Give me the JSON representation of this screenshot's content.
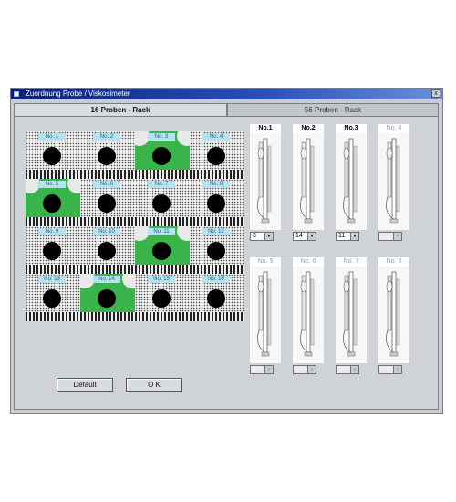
{
  "window": {
    "title": "Zuordnung Probe / Viskosimeter",
    "close_label": "x"
  },
  "tabs": [
    {
      "label": "16 Proben - Rack",
      "active": true
    },
    {
      "label": "56 Proben - Rack",
      "active": false
    }
  ],
  "rack": {
    "cells": [
      {
        "label": "No. 1",
        "selected": false
      },
      {
        "label": "No. 2",
        "selected": false
      },
      {
        "label": "No. 3",
        "selected": true
      },
      {
        "label": "No. 4",
        "selected": false
      },
      {
        "label": "No. 5",
        "selected": true
      },
      {
        "label": "No. 6",
        "selected": false
      },
      {
        "label": "No. 7",
        "selected": false
      },
      {
        "label": "No. 8",
        "selected": false
      },
      {
        "label": "No. 9",
        "selected": false
      },
      {
        "label": "No. 10",
        "selected": false
      },
      {
        "label": "No. 11",
        "selected": true
      },
      {
        "label": "No. 12",
        "selected": false
      },
      {
        "label": "No. 13",
        "selected": false
      },
      {
        "label": "No. 14",
        "selected": true
      },
      {
        "label": "No. 15",
        "selected": false
      },
      {
        "label": "No. 16",
        "selected": false
      }
    ]
  },
  "viscometers": [
    {
      "label": "No.1",
      "enabled": true,
      "value": "3"
    },
    {
      "label": "No.2",
      "enabled": true,
      "value": "14"
    },
    {
      "label": "No.3",
      "enabled": true,
      "value": "11"
    },
    {
      "label": "No. 4",
      "enabled": false,
      "value": ""
    },
    {
      "label": "No. 5",
      "enabled": false,
      "value": ""
    },
    {
      "label": "No. 6",
      "enabled": false,
      "value": ""
    },
    {
      "label": "No. 7",
      "enabled": false,
      "value": ""
    },
    {
      "label": "No. 8",
      "enabled": false,
      "value": ""
    }
  ],
  "buttons": {
    "default_label": "Default",
    "ok_label": "O K"
  }
}
